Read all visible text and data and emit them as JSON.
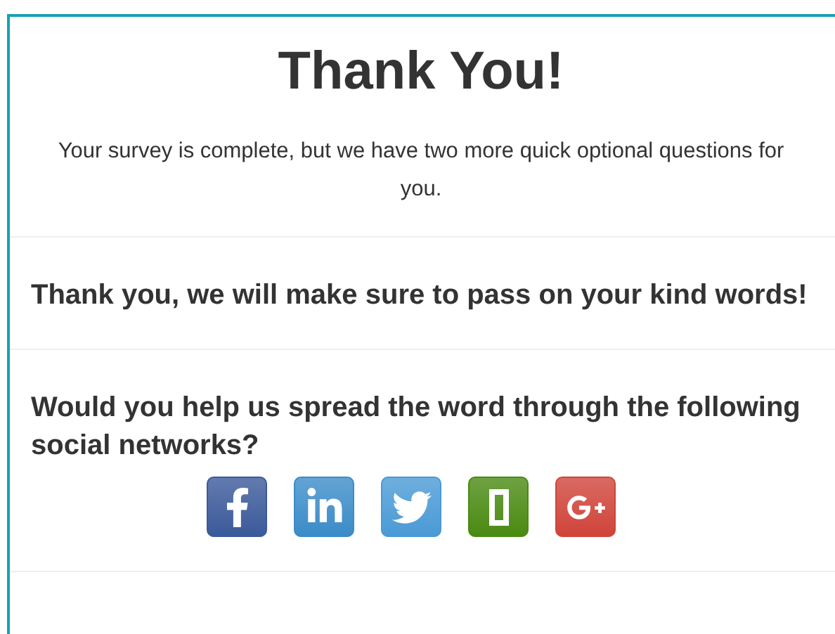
{
  "title": "Thank You!",
  "intro": "Your survey is complete, but we have two more quick optional questions for you.",
  "sections": [
    {
      "heading": "Thank you, we will make sure to pass on your kind words!"
    },
    {
      "heading": "Would you help us spread the word through the following social networks?",
      "networks": [
        {
          "kind": "facebook",
          "color": "#3b5a9a"
        },
        {
          "kind": "linkedin",
          "color": "#3b8cc8"
        },
        {
          "kind": "twitter",
          "color": "#4a9ad6"
        },
        {
          "kind": "glassdoor",
          "color": "#4a8a12"
        },
        {
          "kind": "googleplus",
          "color": "#d0443a"
        }
      ]
    }
  ]
}
